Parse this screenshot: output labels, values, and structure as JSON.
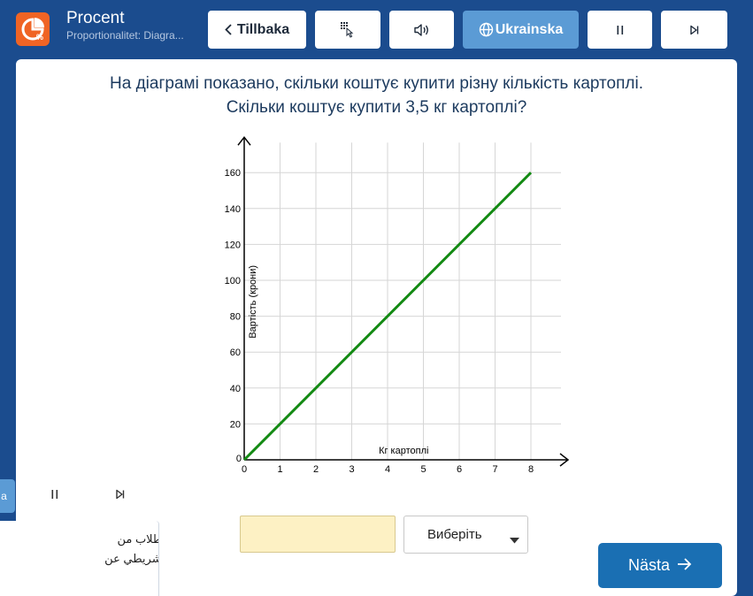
{
  "header": {
    "app_title": "Procent",
    "app_subtitle": "Proportionalitet: Diagra...",
    "back_label": "Tillbaka",
    "language_label": "Ukrainska",
    "accent_color": "#5b9bd5",
    "logo_color": "#f06424",
    "icons": [
      "chart-logo-icon",
      "chevron-left-icon",
      "keypad-pointer-icon",
      "speaker-icon",
      "globe-icon",
      "pause-icon",
      "skip-forward-icon"
    ]
  },
  "question": {
    "line1": "На діаграмі показано, скільки коштує купити різну кількість картоплі.",
    "line2": "Скільки коштує купити 3,5 кг картоплі?"
  },
  "chart_data": {
    "type": "line",
    "xlabel": "Кг картоплі",
    "ylabel": "Вартість (крони)",
    "xlim": [
      0,
      8
    ],
    "ylim": [
      0,
      160
    ],
    "x_ticks": [
      0,
      1,
      2,
      3,
      4,
      5,
      6,
      7,
      8
    ],
    "y_ticks": [
      0,
      20,
      40,
      60,
      80,
      100,
      120,
      140,
      160
    ],
    "grid": true,
    "series": [
      {
        "color": "#138a13",
        "x": [
          0,
          8
        ],
        "y": [
          0,
          160
        ]
      }
    ]
  },
  "answer": {
    "input_value": "",
    "select_value": "Виберіть"
  },
  "next_button": {
    "label": "Nästa",
    "color": "#1a6fb3"
  },
  "overlay": {
    "line1": "كان على الطلاب من",
    "line2": "المخطط الشريطي عن"
  }
}
